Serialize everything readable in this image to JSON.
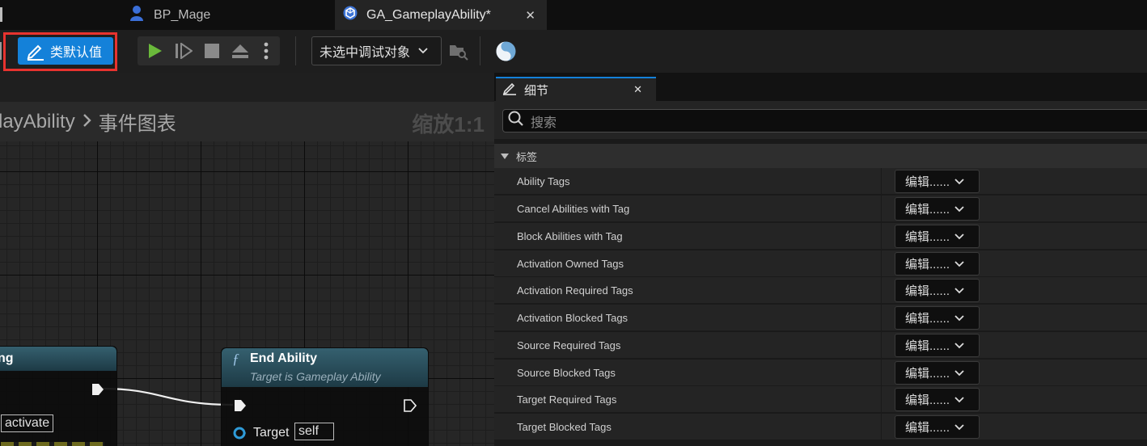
{
  "tabs": [
    {
      "label": "BP_Mage",
      "icon": "character-blueprint-icon"
    },
    {
      "label": "GA_GameplayAbility*",
      "icon": "gameplay-ability-icon"
    }
  ],
  "toolbar": {
    "class_defaults_label": "类默认值",
    "debug_select_value": "未选中调试对象"
  },
  "graph": {
    "breadcrumb_ability": "layAbility",
    "breadcrumb_graph": "事件图表",
    "zoom_label": "缩放1:1",
    "left_node": {
      "title": "ng",
      "pin_value": "activate"
    },
    "end_ability_node": {
      "title": "End Ability",
      "subtitle": "Target is Gameplay Ability",
      "target_label": "Target",
      "target_value": "self"
    }
  },
  "details": {
    "tab_label": "细节",
    "search_placeholder": "搜索",
    "category_label": "标签",
    "edit_label": "编辑......",
    "properties": [
      "Ability Tags",
      "Cancel Abilities with Tag",
      "Block Abilities with Tag",
      "Activation Owned Tags",
      "Activation Required Tags",
      "Activation Blocked Tags",
      "Source Required Tags",
      "Source Blocked Tags",
      "Target Required Tags",
      "Target Blocked Tags"
    ]
  },
  "colors": {
    "accent": "#1481d9",
    "highlight": "#e8332f",
    "play_green": "#6ab93b"
  }
}
